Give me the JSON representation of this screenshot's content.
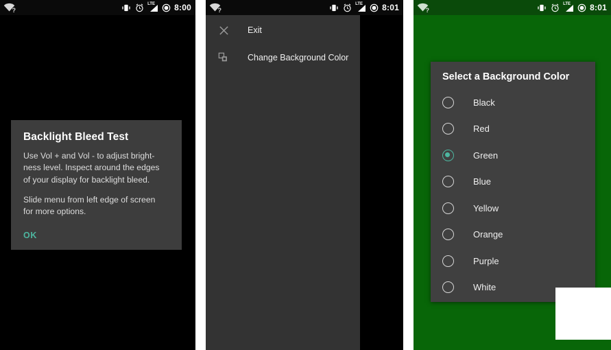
{
  "app": {
    "name": "Backlight Bleed Test",
    "accent_color": "#4db6a0",
    "dialog_bg": "#3d3d3d",
    "drawer_bg": "#333333",
    "green_bg": "#086608",
    "black_bg": "#000000"
  },
  "panels": [
    {
      "id": "panel-main",
      "background_color": "#000000",
      "statusbar": {
        "wifi_icon": "wifi-question-icon",
        "wifi_badge": "?",
        "vibrate_icon": "vibrate-icon",
        "alarm_icon": "alarm-clock-icon",
        "network_label": "LTE",
        "signal_icon": "signal-bars-icon",
        "battery_icon": "battery-icon",
        "time": "8:00"
      },
      "dialog": {
        "title": "Backlight Bleed Test",
        "paragraph_1": "Use Vol + and Vol - to adjust bright-\nness level. Inspect around the edges\nof your display for backlight bleed.",
        "paragraph_2": "Slide menu from left edge of screen\nfor more options.",
        "ok_label": "OK"
      }
    },
    {
      "id": "panel-drawer",
      "background_color": "#000000",
      "statusbar": {
        "wifi_icon": "wifi-question-icon",
        "wifi_badge": "?",
        "vibrate_icon": "vibrate-icon",
        "alarm_icon": "alarm-clock-icon",
        "network_label": "LTE",
        "signal_icon": "signal-bars-icon",
        "battery_icon": "battery-icon",
        "time": "8:01"
      },
      "drawer": {
        "items": [
          {
            "label": "Exit",
            "icon": "close-x-icon"
          },
          {
            "label": "Change Background Color",
            "icon": "layers-icon"
          }
        ]
      }
    },
    {
      "id": "panel-color-picker",
      "background_color": "#086608",
      "statusbar": {
        "wifi_icon": "wifi-question-icon",
        "wifi_badge": "?",
        "vibrate_icon": "vibrate-icon",
        "alarm_icon": "alarm-clock-icon",
        "network_label": "LTE",
        "signal_icon": "signal-bars-icon",
        "battery_icon": "battery-icon",
        "time": "8:01"
      },
      "dialog": {
        "title": "Select a Background Color",
        "selected": "Green",
        "options": [
          {
            "label": "Black",
            "checked": false
          },
          {
            "label": "Red",
            "checked": false
          },
          {
            "label": "Green",
            "checked": true
          },
          {
            "label": "Blue",
            "checked": false
          },
          {
            "label": "Yellow",
            "checked": false
          },
          {
            "label": "Orange",
            "checked": false
          },
          {
            "label": "Purple",
            "checked": false
          },
          {
            "label": "White",
            "checked": false
          }
        ]
      }
    }
  ]
}
